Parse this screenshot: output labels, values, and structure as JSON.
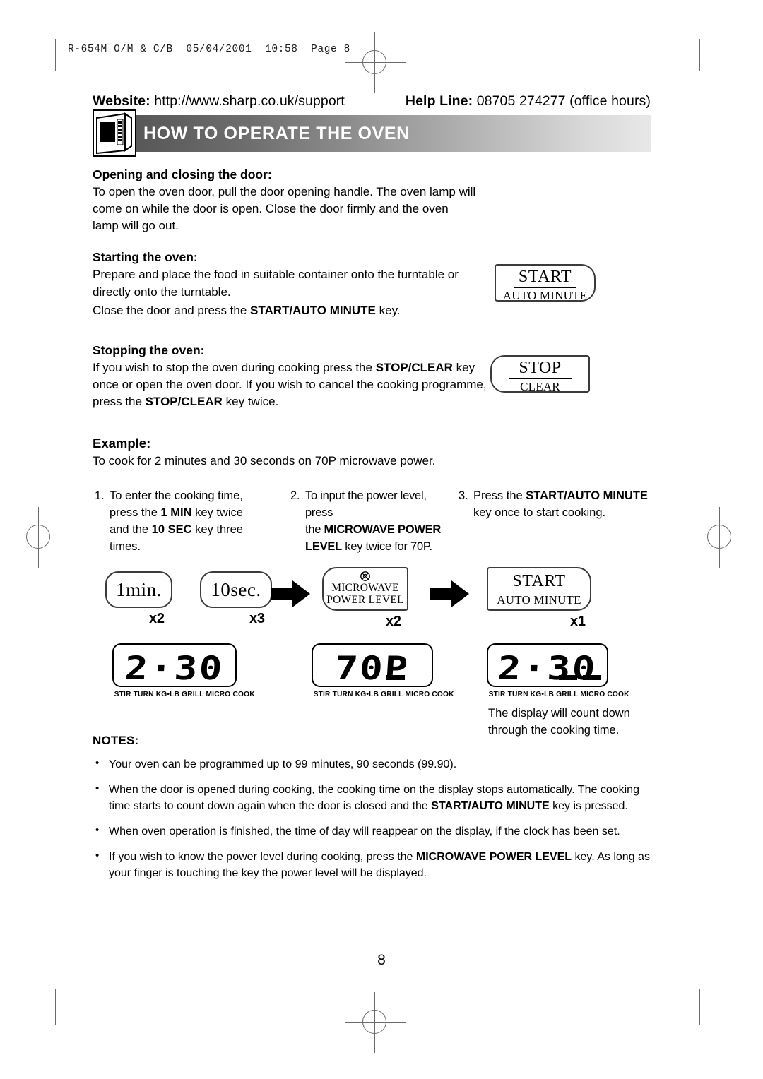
{
  "print_slug": "R-654M O/M & C/B  05/04/2001  10:58  Page 8",
  "header": {
    "website_label": "Website:",
    "website_url": "http://www.sharp.co.uk/support",
    "helpline_label": "Help Line:",
    "helpline_value": "08705 274277 (office hours)"
  },
  "banner": {
    "title": "HOW TO OPERATE THE OVEN",
    "icon": "microwave-oven-icon"
  },
  "sections": [
    {
      "heading": "Opening and closing the door:",
      "lines": [
        "To open the oven door, pull the door opening handle. The oven lamp will come",
        "on while the door is open. Close the door firmly and the oven lamp will go out."
      ]
    },
    {
      "heading": "Starting the oven:",
      "lines": [
        "Prepare and place the food in suitable container onto the turntable or directly",
        "onto the turntable."
      ],
      "closing_prefix": "Close the door and press the ",
      "closing_bold": "START/AUTO MINUTE",
      "closing_suffix": " key."
    },
    {
      "heading": "Stopping the oven:",
      "line1_a": "If you wish to stop the oven during cooking press the ",
      "line1_b": "STOP/CLEAR",
      "line1_c": " key once",
      "line2": "or open the oven door. If you wish to cancel the cooking programme, press the",
      "line3_a": "STOP/CLEAR",
      "line3_b": " key twice."
    },
    {
      "heading": "Example:",
      "lines": [
        "To cook for 2 minutes and 30 seconds on 70P microwave power."
      ]
    }
  ],
  "keys": {
    "start": {
      "top": "START",
      "bottom": "AUTO MINUTE"
    },
    "stop": {
      "top": "STOP",
      "bottom": "CLEAR"
    },
    "one_min": {
      "label": "1min.",
      "multiplier": "x2"
    },
    "ten_sec": {
      "label": "10sec.",
      "multiplier": "x3"
    },
    "power_level": {
      "icon": "microwave-emission-icon",
      "line1": "MICROWAVE",
      "line2": "POWER LEVEL",
      "multiplier": "x2"
    },
    "start_seq": {
      "top": "START",
      "bottom": "AUTO MINUTE",
      "multiplier": "x1"
    }
  },
  "steps": [
    {
      "num": "1.",
      "t1": "To enter the cooking time,",
      "t2_a": "press the ",
      "t2_b": "1 MIN",
      "t2_c": " key twice",
      "t3_a": "and the ",
      "t3_b": "10 SEC",
      "t3_c": " key three",
      "t4": "times."
    },
    {
      "num": "2.",
      "t1": "To input the power level, press",
      "t2_a": "the ",
      "t2_b": "MICROWAVE POWER",
      "t3_a": "LEVEL",
      "t3_b": " key twice for 70P."
    },
    {
      "num": "3.",
      "t1_a": "Press the ",
      "t1_b": "START/AUTO MINUTE",
      "t2": "key once to start cooking."
    }
  ],
  "displays": [
    {
      "value": "2·30",
      "indicators": [],
      "labels": "STIR  TURN  KG•LB  GRILL  MICRO  COOK"
    },
    {
      "value": "70P",
      "indicators": [
        "MICRO"
      ],
      "labels": "STIR  TURN  KG•LB  GRILL  MICRO  COOK"
    },
    {
      "value": "2·30",
      "indicators": [
        "MICRO",
        "COOK"
      ],
      "labels": "STIR  TURN  KG•LB  GRILL  MICRO  COOK"
    }
  ],
  "caption": {
    "line1": "The display will count down",
    "line2": "through the cooking time."
  },
  "notes": {
    "heading": "NOTES:",
    "items": [
      {
        "text": "Your oven can be programmed up to 99 minutes, 90 seconds (99.90)."
      },
      {
        "a": "When the door is opened during cooking, the cooking time on the display stops automatically. The cooking time starts to count down again when the door is closed and the ",
        "b": "START/AUTO MINUTE",
        "c": " key is pressed."
      },
      {
        "text": "When oven operation is finished, the time of day will reappear on the display, if the clock has been set."
      },
      {
        "a": "If you wish to know the power level during cooking, press the ",
        "b": "MICROWAVE POWER LEVEL",
        "c": " key. As long as your finger is touching the key the power level will be displayed."
      }
    ]
  },
  "page_number": "8"
}
